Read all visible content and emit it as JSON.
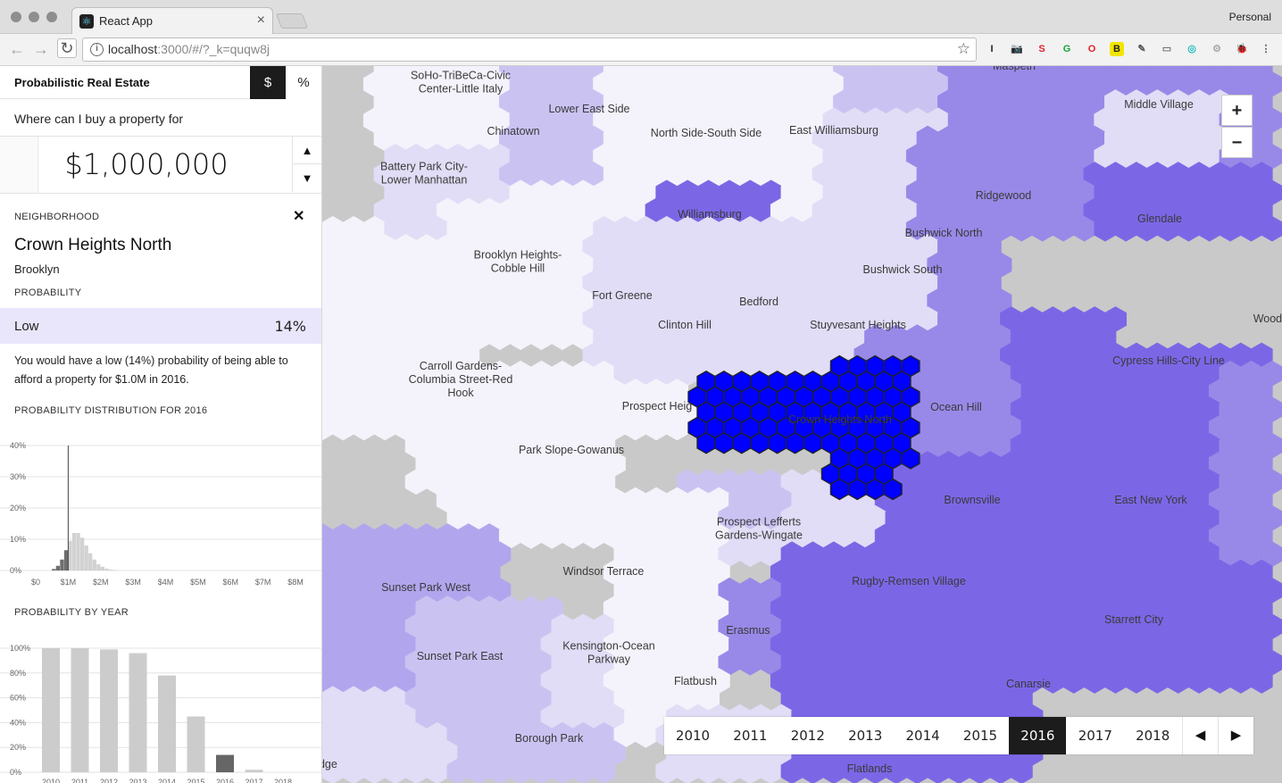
{
  "browser": {
    "tab_title": "React App",
    "tab_favicon": "react-icon",
    "profile": "Personal",
    "url_host": "localhost",
    "url_rest": ":3000/#/?_k=quqw8j",
    "extensions": [
      "I",
      "📷",
      "S",
      "G",
      "O",
      "B",
      "✎",
      "▭",
      "◎",
      "⚙",
      "🐞"
    ]
  },
  "sidebar": {
    "title": "Probabilistic Real Estate",
    "mode_dollar": "$",
    "mode_percent": "%",
    "question": "Where can I buy a property for",
    "price": "$1,000,000",
    "price_up": "▲",
    "price_down": "▼",
    "neighborhood_label": "NEIGHBORHOOD",
    "close": "✕",
    "neighborhood_name": "Crown Heights North",
    "borough": "Brooklyn",
    "probability_label": "PROBABILITY",
    "probability_level": "Low",
    "probability_value": "14%",
    "probability_text": "You would have a low (14%) probability of being able to afford a property for $1.0M in 2016.",
    "distribution_title": "PROBABILITY DISTRIBUTION FOR 2016",
    "by_year_title": "PROBABILITY BY YEAR"
  },
  "chart_data": [
    {
      "type": "bar",
      "title": "PROBABILITY DISTRIBUTION FOR 2016",
      "ytick_labels": [
        "0%",
        "10%",
        "20%",
        "30%",
        "40%"
      ],
      "yticks": [
        0,
        10,
        20,
        30,
        40
      ],
      "ylim": [
        0,
        40
      ],
      "xtick_labels": [
        "$0",
        "$1M",
        "$2M",
        "$3M",
        "$4M",
        "$5M",
        "$6M",
        "$7M",
        "$8M"
      ],
      "xlim": [
        0,
        8
      ],
      "marker_x": 1.0,
      "bin_width": 0.125,
      "bins_x": [
        0.5,
        0.625,
        0.75,
        0.875,
        1.0,
        1.125,
        1.25,
        1.375,
        1.5,
        1.625,
        1.75,
        1.875,
        2.0,
        2.125,
        2.25,
        2.375
      ],
      "values": [
        0.5,
        1.5,
        3.5,
        6.5,
        9.5,
        12,
        12,
        10.5,
        8,
        5.5,
        3.5,
        2,
        1.2,
        0.6,
        0.3,
        0.2
      ],
      "dark_before_x": 1.0,
      "colors": {
        "below": "#6e6e6e",
        "above": "#d2d2d2",
        "marker": "#444444",
        "grid": "#e3e3e3"
      },
      "grid": true
    },
    {
      "type": "bar",
      "title": "PROBABILITY BY YEAR",
      "categories": [
        "2010",
        "2011",
        "2012",
        "2013",
        "2014",
        "2015",
        "2016",
        "2017",
        "2018"
      ],
      "values": [
        100,
        100,
        99,
        96,
        78,
        45,
        14,
        2,
        0
      ],
      "ytick_labels": [
        "0%",
        "20%",
        "40%",
        "60%",
        "80%",
        "100%"
      ],
      "yticks": [
        0,
        20,
        40,
        60,
        80,
        100
      ],
      "ylim": [
        0,
        100
      ],
      "highlight_index": 6,
      "colors": {
        "bar": "#cccccc",
        "highlight": "#666666",
        "grid": "#e3e3e3"
      },
      "grid": true
    }
  ],
  "map": {
    "colors": {
      "water": "#c9c9c9",
      "very_light": "#f4f3fb",
      "light": "#e1ddf6",
      "light_mid": "#cac3f2",
      "mid": "#b1a6ee",
      "mid_dark": "#9889e8",
      "dark": "#7b67e6",
      "selected": "#0000ff"
    },
    "labels": [
      "Maspeth",
      "SoHo-TriBeCa-Civic Center-Little Italy",
      "Lower East Side",
      "Chinatown",
      "North Side-South Side",
      "East Williamsburg",
      "Middle Village",
      "Battery Park City-Lower Manhattan",
      "Williamsburg",
      "Ridgewood",
      "Glendale",
      "Bushwick North",
      "Brooklyn Heights-Cobble Hill",
      "Bushwick South",
      "Fort Greene",
      "Bedford",
      "Clinton Hill",
      "Stuyvesant Heights",
      "Woodhaven",
      "Cypress Hills-City Line",
      "Carroll Gardens-Columbia Street-Red Hook",
      "Prospect Heights",
      "Crown Heights North",
      "Ocean Hill",
      "Park Slope-Gowanus",
      "Brownsville",
      "East New York",
      "Prospect Lefferts Gardens-Wingate",
      "Windsor Terrace",
      "Sunset Park West",
      "Rugby-Remsen Village",
      "Erasmus",
      "Starrett City",
      "Kensington-Ocean Parkway",
      "Sunset Park East",
      "Flatbush",
      "Canarsie",
      "Borough Park",
      "Flatlands",
      "Bay Ridge"
    ],
    "zoom_in": "+",
    "zoom_out": "−"
  },
  "years": {
    "items": [
      "2010",
      "2011",
      "2012",
      "2013",
      "2014",
      "2015",
      "2016",
      "2017",
      "2018"
    ],
    "active": "2016",
    "prev": "◀",
    "next": "▶"
  }
}
